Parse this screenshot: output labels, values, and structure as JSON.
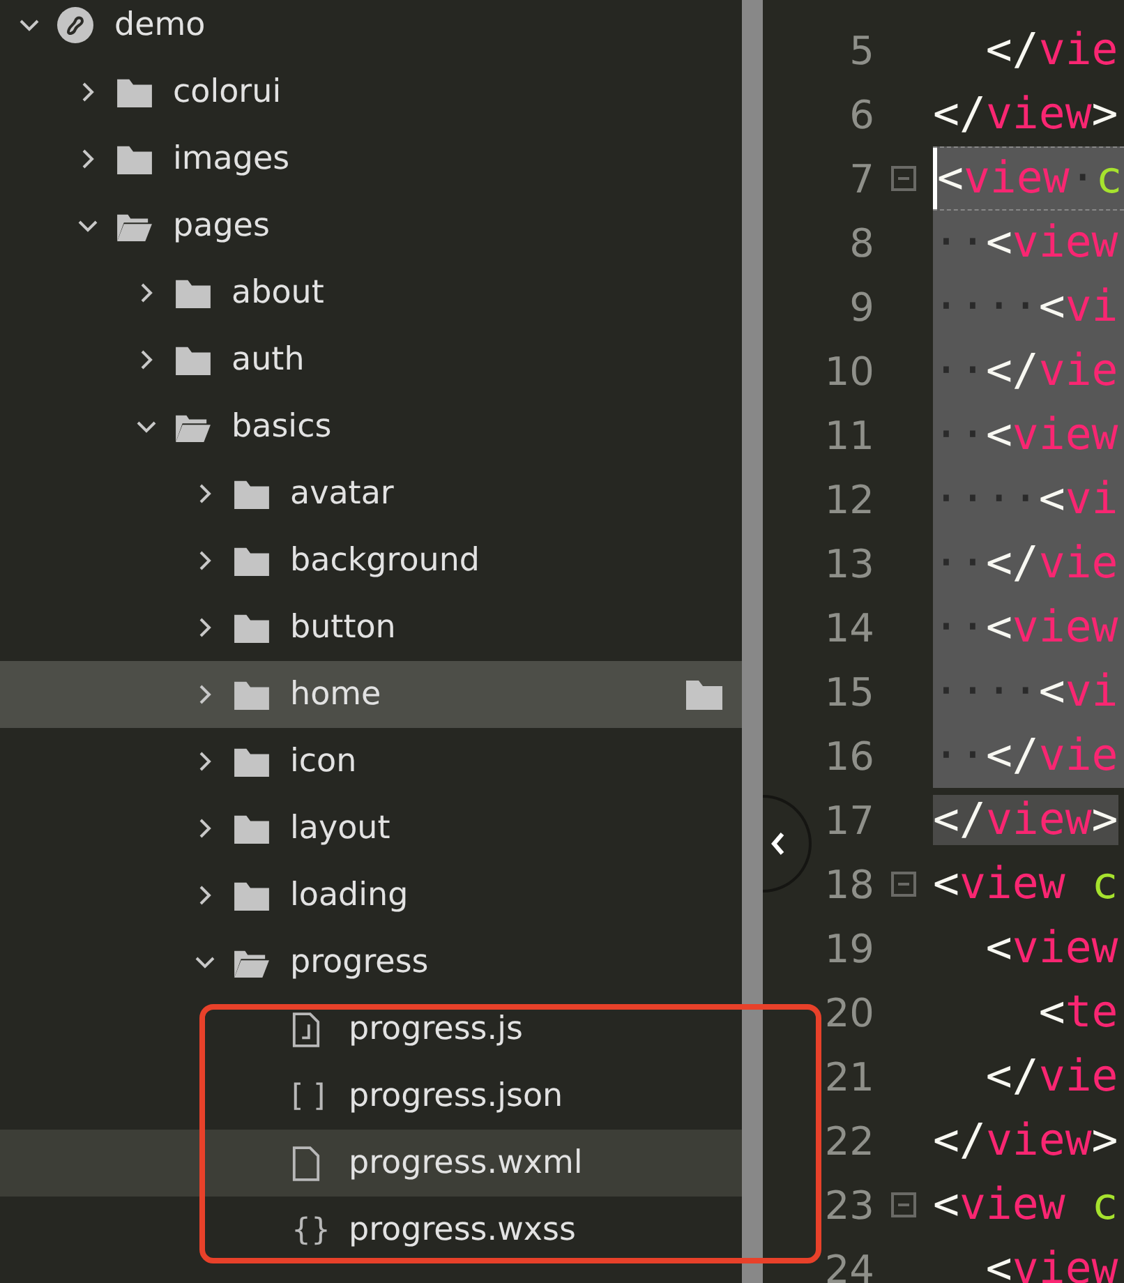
{
  "file_tree": [
    {
      "name": "demo",
      "kind": "project",
      "expanded": true,
      "selected": false,
      "hovered": false,
      "children": [
        {
          "name": "colorui",
          "kind": "folder",
          "expanded": false,
          "selected": false,
          "hovered": false
        },
        {
          "name": "images",
          "kind": "folder",
          "expanded": false,
          "selected": false,
          "hovered": false
        },
        {
          "name": "pages",
          "kind": "folder",
          "expanded": true,
          "selected": false,
          "hovered": false,
          "children": [
            {
              "name": "about",
              "kind": "folder",
              "expanded": false,
              "selected": false,
              "hovered": false
            },
            {
              "name": "auth",
              "kind": "folder",
              "expanded": false,
              "selected": false,
              "hovered": false
            },
            {
              "name": "basics",
              "kind": "folder",
              "expanded": true,
              "selected": false,
              "hovered": false,
              "children": [
                {
                  "name": "avatar",
                  "kind": "folder",
                  "expanded": false,
                  "selected": false,
                  "hovered": false
                },
                {
                  "name": "background",
                  "kind": "folder",
                  "expanded": false,
                  "selected": false,
                  "hovered": false
                },
                {
                  "name": "button",
                  "kind": "folder",
                  "expanded": false,
                  "selected": false,
                  "hovered": false
                },
                {
                  "name": "home",
                  "kind": "folder",
                  "expanded": false,
                  "selected": false,
                  "hovered": true
                },
                {
                  "name": "icon",
                  "kind": "folder",
                  "expanded": false,
                  "selected": false,
                  "hovered": false
                },
                {
                  "name": "layout",
                  "kind": "folder",
                  "expanded": false,
                  "selected": false,
                  "hovered": false
                },
                {
                  "name": "loading",
                  "kind": "folder",
                  "expanded": false,
                  "selected": false,
                  "hovered": false
                },
                {
                  "name": "progress",
                  "kind": "folder",
                  "expanded": true,
                  "selected": false,
                  "hovered": false,
                  "children": [
                    {
                      "name": "progress.js",
                      "kind": "script-file",
                      "selected": false,
                      "hovered": false
                    },
                    {
                      "name": "progress.json",
                      "kind": "glyph-file",
                      "glyph": "[ ]",
                      "selected": false,
                      "hovered": false
                    },
                    {
                      "name": "progress.wxml",
                      "kind": "page-file",
                      "selected": true,
                      "hovered": false
                    },
                    {
                      "name": "progress.wxss",
                      "kind": "glyph-file",
                      "glyph": "{}",
                      "selected": false,
                      "hovered": false
                    }
                  ]
                }
              ]
            }
          ]
        }
      ]
    }
  ],
  "editor": {
    "lines": [
      {
        "number": "5",
        "fold": false,
        "selected": false,
        "current": false,
        "matched": false,
        "tokens": [
          {
            "kind": "punct",
            "text": "  </"
          },
          {
            "kind": "tag",
            "text": "vie"
          }
        ]
      },
      {
        "number": "6",
        "fold": false,
        "selected": false,
        "current": false,
        "matched": false,
        "tokens": [
          {
            "kind": "punct",
            "text": "</"
          },
          {
            "kind": "tag",
            "text": "view"
          },
          {
            "kind": "punct",
            "text": ">"
          }
        ]
      },
      {
        "number": "7",
        "fold": true,
        "selected": true,
        "current": true,
        "matched": false,
        "tokens": [
          {
            "kind": "punct",
            "text": "<"
          },
          {
            "kind": "tag",
            "text": "view"
          },
          {
            "kind": "ws",
            "text": "·"
          },
          {
            "kind": "attr",
            "text": "c"
          }
        ]
      },
      {
        "number": "8",
        "fold": false,
        "selected": true,
        "current": false,
        "matched": false,
        "tokens": [
          {
            "kind": "ws",
            "text": "··"
          },
          {
            "kind": "punct",
            "text": "<"
          },
          {
            "kind": "tag",
            "text": "view"
          }
        ]
      },
      {
        "number": "9",
        "fold": false,
        "selected": true,
        "current": false,
        "matched": false,
        "tokens": [
          {
            "kind": "ws",
            "text": "····"
          },
          {
            "kind": "punct",
            "text": "<"
          },
          {
            "kind": "tag",
            "text": "vi"
          }
        ]
      },
      {
        "number": "10",
        "fold": false,
        "selected": true,
        "current": false,
        "matched": false,
        "tokens": [
          {
            "kind": "ws",
            "text": "··"
          },
          {
            "kind": "punct",
            "text": "</"
          },
          {
            "kind": "tag",
            "text": "vie"
          }
        ]
      },
      {
        "number": "11",
        "fold": false,
        "selected": true,
        "current": false,
        "matched": false,
        "tokens": [
          {
            "kind": "ws",
            "text": "··"
          },
          {
            "kind": "punct",
            "text": "<"
          },
          {
            "kind": "tag",
            "text": "view"
          }
        ]
      },
      {
        "number": "12",
        "fold": false,
        "selected": true,
        "current": false,
        "matched": false,
        "tokens": [
          {
            "kind": "ws",
            "text": "····"
          },
          {
            "kind": "punct",
            "text": "<"
          },
          {
            "kind": "tag",
            "text": "vi"
          }
        ]
      },
      {
        "number": "13",
        "fold": false,
        "selected": true,
        "current": false,
        "matched": false,
        "tokens": [
          {
            "kind": "ws",
            "text": "··"
          },
          {
            "kind": "punct",
            "text": "</"
          },
          {
            "kind": "tag",
            "text": "vie"
          }
        ]
      },
      {
        "number": "14",
        "fold": false,
        "selected": true,
        "current": false,
        "matched": false,
        "tokens": [
          {
            "kind": "ws",
            "text": "··"
          },
          {
            "kind": "punct",
            "text": "<"
          },
          {
            "kind": "tag",
            "text": "view"
          }
        ]
      },
      {
        "number": "15",
        "fold": false,
        "selected": true,
        "current": false,
        "matched": false,
        "tokens": [
          {
            "kind": "ws",
            "text": "····"
          },
          {
            "kind": "punct",
            "text": "<"
          },
          {
            "kind": "tag",
            "text": "vi"
          }
        ]
      },
      {
        "number": "16",
        "fold": false,
        "selected": true,
        "current": false,
        "matched": false,
        "tokens": [
          {
            "kind": "ws",
            "text": "··"
          },
          {
            "kind": "punct",
            "text": "</"
          },
          {
            "kind": "tag",
            "text": "vie"
          }
        ]
      },
      {
        "number": "17",
        "fold": false,
        "selected": false,
        "current": false,
        "matched": true,
        "tokens": [
          {
            "kind": "punct",
            "text": "</"
          },
          {
            "kind": "tag",
            "text": "view"
          },
          {
            "kind": "punct",
            "text": ">"
          }
        ]
      },
      {
        "number": "18",
        "fold": true,
        "selected": false,
        "current": false,
        "matched": false,
        "tokens": [
          {
            "kind": "punct",
            "text": "<"
          },
          {
            "kind": "tag",
            "text": "view"
          },
          {
            "kind": "attr",
            "text": " c"
          }
        ]
      },
      {
        "number": "19",
        "fold": false,
        "selected": false,
        "current": false,
        "matched": false,
        "tokens": [
          {
            "kind": "punct",
            "text": "  <"
          },
          {
            "kind": "tag",
            "text": "view"
          }
        ]
      },
      {
        "number": "20",
        "fold": false,
        "selected": false,
        "current": false,
        "matched": false,
        "tokens": [
          {
            "kind": "punct",
            "text": "    <"
          },
          {
            "kind": "tag",
            "text": "te"
          }
        ]
      },
      {
        "number": "21",
        "fold": false,
        "selected": false,
        "current": false,
        "matched": false,
        "tokens": [
          {
            "kind": "punct",
            "text": "  </"
          },
          {
            "kind": "tag",
            "text": "vie"
          }
        ]
      },
      {
        "number": "22",
        "fold": false,
        "selected": false,
        "current": false,
        "matched": false,
        "tokens": [
          {
            "kind": "punct",
            "text": "</"
          },
          {
            "kind": "tag",
            "text": "view"
          },
          {
            "kind": "punct",
            "text": ">"
          }
        ]
      },
      {
        "number": "23",
        "fold": true,
        "selected": false,
        "current": false,
        "matched": false,
        "tokens": [
          {
            "kind": "punct",
            "text": "<"
          },
          {
            "kind": "tag",
            "text": "view"
          },
          {
            "kind": "attr",
            "text": " c"
          }
        ]
      },
      {
        "number": "24",
        "fold": false,
        "selected": false,
        "current": false,
        "matched": false,
        "tokens": [
          {
            "kind": "punct",
            "text": "  <"
          },
          {
            "kind": "tag",
            "text": "view"
          }
        ]
      }
    ]
  }
}
